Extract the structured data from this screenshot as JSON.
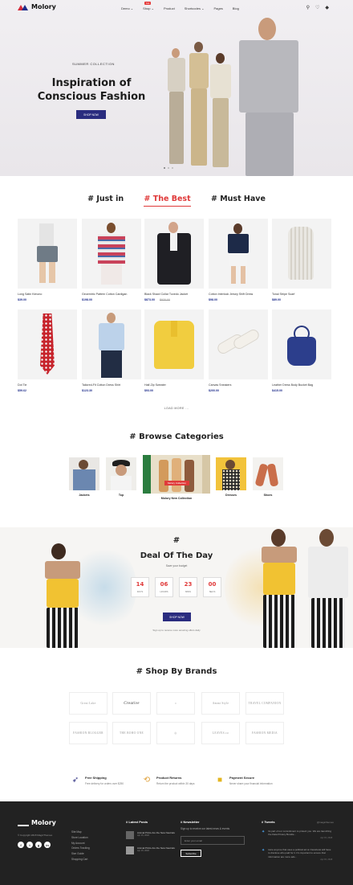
{
  "header": {
    "logo": "Molory",
    "nav": [
      "Demo ⌄",
      "Shop ⌄",
      "Product",
      "Shortcodes ⌄",
      "Pages",
      "Blog"
    ],
    "hot_badge": "hot",
    "icons": [
      "search-icon",
      "heart-icon",
      "user-icon",
      "cart-icon"
    ]
  },
  "hero": {
    "subtitle": "SUMMER COLLECTION",
    "title": "Inspiration of Conscious Fashion",
    "button": "SHOP NOW"
  },
  "tabs": [
    "# Just in",
    "# The Best",
    "# Must Have"
  ],
  "products": [
    {
      "name": "Long Satin Kimono",
      "price": "$39.00",
      "old": ""
    },
    {
      "name": "Geoemtric Pattern Cotton Cardigan",
      "price": "$198.00",
      "old": ""
    },
    {
      "name": "Black Shawl Collar Tuxedo Jacket",
      "price": "$873.00",
      "old": "$930.00"
    },
    {
      "name": "Cotton Interlock Jersey Shift Dress",
      "price": "$98.00",
      "old": ""
    },
    {
      "name": "Tonal Stripe Scarf",
      "price": "$89.00",
      "old": ""
    },
    {
      "name": "Dot Tie",
      "price": "$59.62",
      "old": ""
    },
    {
      "name": "Tailored-Fit Cotton Dress Shirt",
      "price": "$123.30",
      "old": ""
    },
    {
      "name": "Half-Zip Sweater",
      "price": "$93.00",
      "old": ""
    },
    {
      "name": "Canvas Sneakers",
      "price": "$200.00",
      "old": ""
    },
    {
      "name": "Leather Dress Body Bucket Bag",
      "price": "$415.00",
      "old": ""
    }
  ],
  "load_more": "LOAD MORE ...",
  "categories": {
    "title": "# Browse Categories",
    "items": [
      "Jackets",
      "Top",
      "Molory New Collection",
      "Dresses",
      "Shoes"
    ],
    "tag": "Molory Collection"
  },
  "deal": {
    "hash": "#",
    "title": "Deal Of The Day",
    "caption": "Save your budget",
    "countdown": [
      {
        "n": "14",
        "u": "DAYS"
      },
      {
        "n": "06",
        "u": "HOURS"
      },
      {
        "n": "23",
        "u": "MINS"
      },
      {
        "n": "00",
        "u": "SECS"
      }
    ],
    "button": "SHOP NOW",
    "note": "Sign up to receive more amazing offers daily"
  },
  "brands": {
    "title": "# Shop By Brands",
    "items": [
      "Great Lake",
      "Creative",
      "",
      "Ammi Style",
      "TRAVEL COMPANION",
      "FASHION BLOGGER",
      "THE BOHO ONE",
      "",
      "LEAVES.co",
      "FASHION MEDIA"
    ]
  },
  "features": [
    {
      "icon": "rocket-icon",
      "title": "Free Shipping",
      "desc": "Free delivery for orders over $250"
    },
    {
      "icon": "return-icon",
      "title": "Product Returns",
      "desc": "Return the product within 30 days"
    },
    {
      "icon": "lock-icon",
      "title": "Payment Secure",
      "desc": "Never share your financial information"
    }
  ],
  "footer": {
    "logo": "Molory",
    "copyright": "© Copyright 2018 MagicThemes",
    "social": [
      "f",
      "t",
      "g",
      "in"
    ],
    "links": [
      "Site Map",
      "Store Location",
      "My Account",
      "Orders Tracking",
      "Size Guide",
      "Shopping Cart"
    ],
    "posts_title": "# Latest Posts",
    "posts": [
      {
        "title": "Animal Prints Are the New Neutrals",
        "date": "Apr 15, 2018"
      },
      {
        "title": "Animal Prints Are the New Neutrals",
        "date": "Apr 15, 2018"
      }
    ],
    "newsletter_title": "# Newsletter",
    "newsletter_text": "Sign up to receive our latest news & events",
    "newsletter_placeholder": "Enter your email",
    "subscribe": "Subscribe",
    "tweets_title": "# Tweets",
    "tweets_handle": "@magicthemes",
    "tweets": [
      {
        "text": "Its part of our commitment to protect you. We are launching the Data Privacy Bundle...",
        "date": "Apr 15, 2018"
      },
      {
        "text": "Here anyone that uses a political ad on Facebook will have to disclose who paid for it. It's important to ensure that information are more ads...",
        "date": "Apr 15, 2018"
      }
    ]
  }
}
